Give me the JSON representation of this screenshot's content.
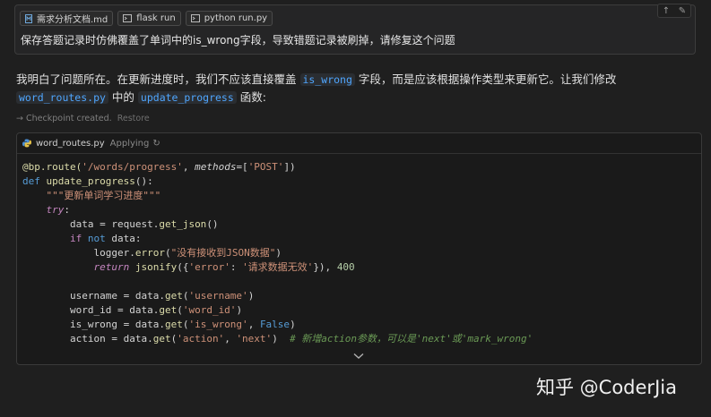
{
  "user_message": {
    "chips": [
      {
        "icon": "markdown-file-icon",
        "label": "需求分析文档.md"
      },
      {
        "icon": "terminal-icon",
        "label": "flask run"
      },
      {
        "icon": "terminal-icon",
        "label": "python run.py"
      }
    ],
    "text": "保存答题记录时仿佛覆盖了单词中的is_wrong字段，导致错题记录被刷掉，请修复这个问题",
    "actions": [
      "up-arrow-icon",
      "pencil-icon"
    ]
  },
  "assistant": {
    "text_1": "我明白了问题所在。在更新进度时，我们不应该直接覆盖",
    "code_1": "is_wrong",
    "text_2": "字段，而是应该根据操作类型来更新它。让我们修改",
    "code_2": "word_routes.py",
    "text_3": "中的",
    "code_3": "update_progress",
    "text_4": "函数:"
  },
  "checkpoint": {
    "label": "Checkpoint created.",
    "restore": "Restore"
  },
  "code_card": {
    "filename": "word_routes.py",
    "status": "Applying",
    "lines": {
      "l1_dec": "@bp.route(",
      "l1_str": "'/words/progress'",
      "l1_sep": ", ",
      "l1_kw": "methods",
      "l1_eq": "=[",
      "l1_str2": "'POST'",
      "l1_end": "])",
      "l2_def": "def ",
      "l2_fn": "update_progress",
      "l2_end": "():",
      "l3": "\"\"\"更新单词学习进度\"\"\"",
      "l4": "try",
      "l5_a": "data = request.",
      "l5_fn": "get_json",
      "l5_b": "()",
      "l6_if": "if ",
      "l6_not": "not",
      "l6_b": " data:",
      "l7_a": "logger.",
      "l7_fn": "error",
      "l7_b": "(",
      "l7_str": "\"没有接收到JSON数据\"",
      "l7_c": ")",
      "l8_ret": "return ",
      "l8_fn": "jsonify",
      "l8_a": "({",
      "l8_s1": "'error'",
      "l8_b": ": ",
      "l8_s2": "'请求数据无效'",
      "l8_c": "}), ",
      "l8_num": "400",
      "l10_a": "username = data.",
      "l10_fn": "get",
      "l10_s": "'username'",
      "l11_a": "word_id = data.",
      "l11_s": "'word_id'",
      "l12_a": "is_wrong = data.",
      "l12_s": "'is_wrong'",
      "l12_kw": "False",
      "l13_a": "action = data.",
      "l13_s1": "'action'",
      "l13_s2": "'next'",
      "l13_cm": "# 新增action参数，可以是'next'或'mark_wrong'"
    }
  },
  "watermark": "知乎 @CoderJia"
}
